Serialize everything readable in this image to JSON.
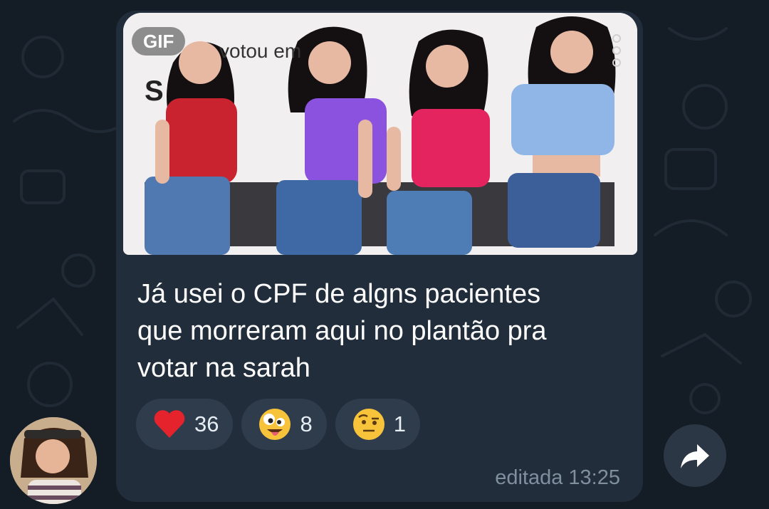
{
  "message": {
    "media_badge": "GIF",
    "gif_caption_partial": "votou em",
    "gif_caption_letter": "S",
    "text": "Já usei o CPF de algns pacientes\nque morreram aqui no plantão pra\nvotar na sarah",
    "reactions": [
      {
        "emoji": "heart",
        "count": "36"
      },
      {
        "emoji": "zany-face",
        "count": "8"
      },
      {
        "emoji": "raised-eyebrow-face",
        "count": "1"
      }
    ],
    "timestamp": "editada 13:25"
  },
  "colors": {
    "background": "#141d26",
    "bubble": "#212d3b",
    "reaction_pill": "#2f3c4c",
    "timestamp": "#7f8f9e",
    "heart": "#e4232c"
  },
  "icons": {
    "forward": "forward-arrow-icon",
    "avatar": "sender-avatar"
  }
}
